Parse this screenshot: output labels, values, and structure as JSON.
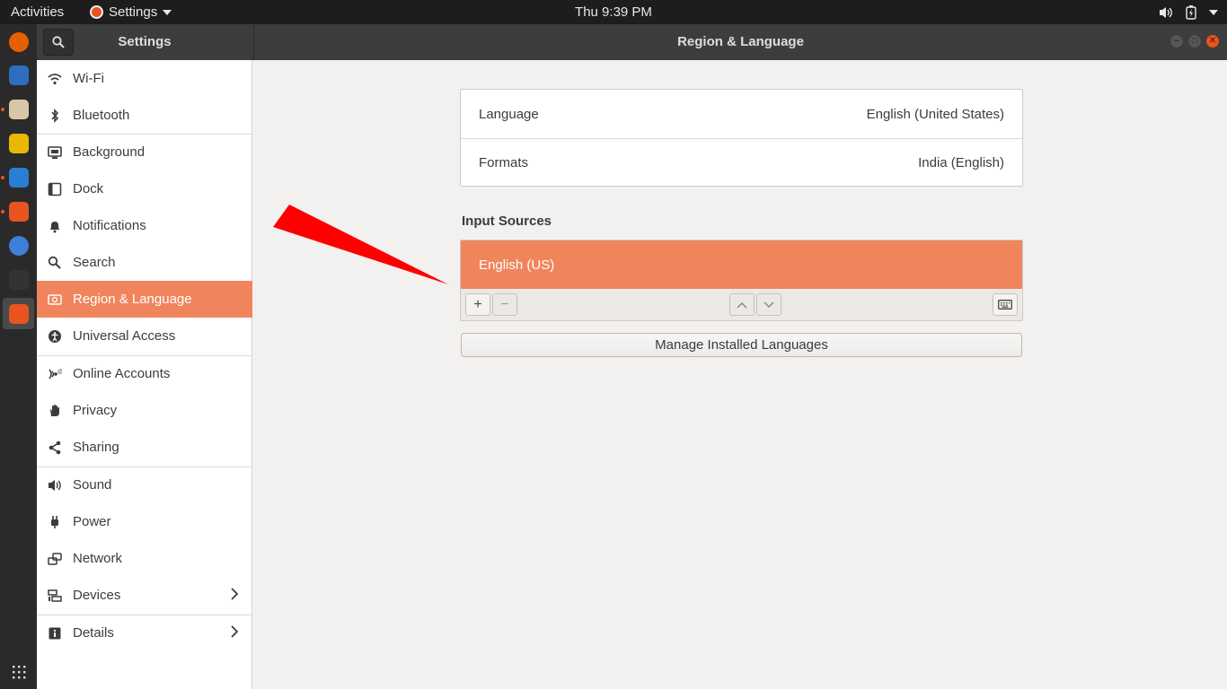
{
  "topbar": {
    "activities": "Activities",
    "app_name": "Settings",
    "clock": "Thu  9:39 PM"
  },
  "dock": {
    "apps": [
      {
        "icon": "firefox-icon",
        "color": "#e66000",
        "running": false
      },
      {
        "icon": "thunderbird-icon",
        "color": "#2f6dbf",
        "running": false
      },
      {
        "icon": "file-manager-icon",
        "color": "#d7c7a7",
        "running": true
      },
      {
        "icon": "rhythmbox-icon",
        "color": "#e8b800",
        "running": false
      },
      {
        "icon": "libreoffice-writer-icon",
        "color": "#2a7fd4",
        "running": true
      },
      {
        "icon": "software-center-icon",
        "color": "#e95420",
        "running": true
      },
      {
        "icon": "chromium-icon",
        "color": "#3d7fd9",
        "running": false
      },
      {
        "icon": "terminal-icon",
        "color": "#333333",
        "running": false
      },
      {
        "icon": "settings-icon",
        "color": "#e95420",
        "running": false
      }
    ],
    "show_apps_icon": "grid-icon"
  },
  "header": {
    "left_title": "Settings",
    "main_title": "Region & Language"
  },
  "sidebar": {
    "items": [
      {
        "label": "Wi-Fi",
        "icon": "wifi-icon"
      },
      {
        "label": "Bluetooth",
        "icon": "bluetooth-icon"
      },
      {
        "label": "Background",
        "icon": "background-icon"
      },
      {
        "label": "Dock",
        "icon": "dock-icon"
      },
      {
        "label": "Notifications",
        "icon": "bell-icon"
      },
      {
        "label": "Search",
        "icon": "search-icon"
      },
      {
        "label": "Region & Language",
        "icon": "region-icon",
        "selected": true
      },
      {
        "label": "Universal Access",
        "icon": "accessibility-icon"
      },
      {
        "label": "Online Accounts",
        "icon": "online-accounts-icon"
      },
      {
        "label": "Privacy",
        "icon": "hand-icon"
      },
      {
        "label": "Sharing",
        "icon": "share-icon"
      },
      {
        "label": "Sound",
        "icon": "speaker-icon"
      },
      {
        "label": "Power",
        "icon": "power-plug-icon"
      },
      {
        "label": "Network",
        "icon": "network-icon"
      },
      {
        "label": "Devices",
        "icon": "devices-icon",
        "has_submenu": true
      },
      {
        "label": "Details",
        "icon": "info-icon",
        "has_submenu": true
      }
    ]
  },
  "main": {
    "language_label": "Language",
    "language_value": "English (United States)",
    "formats_label": "Formats",
    "formats_value": "India (English)",
    "input_sources_title": "Input Sources",
    "input_sources": [
      "English (US)"
    ],
    "add_symbol": "+",
    "remove_symbol": "−",
    "manage_button": "Manage Installed Languages"
  },
  "colors": {
    "selection": "#f0855d",
    "accent": "#e95420",
    "annotation_arrow": "#ff0000"
  }
}
